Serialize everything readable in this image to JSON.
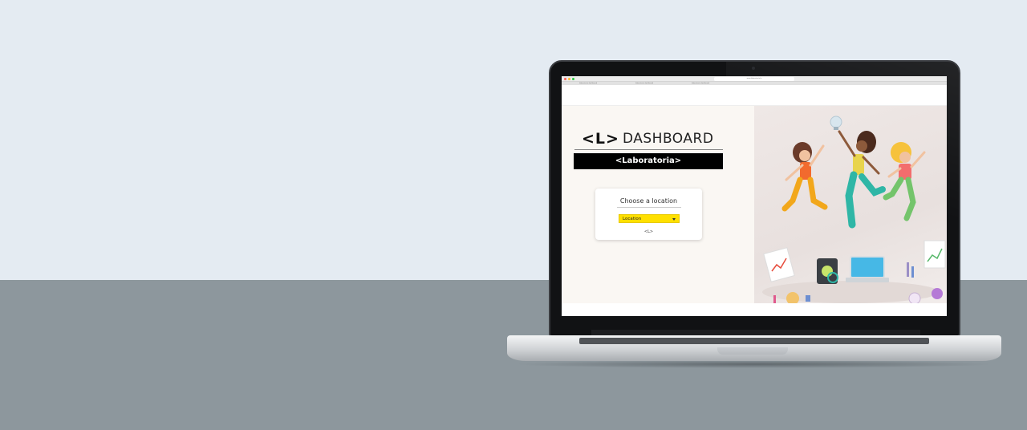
{
  "browser": {
    "url": "www.laboratoria.la",
    "tabs": [
      "laboratoria dashboard",
      "laboratoria dashboard",
      "laboratoria dashboard"
    ]
  },
  "dashboard": {
    "logo_mark": "<L>",
    "logo_title": "DASHBOARD",
    "brand": "<Laboratoria>"
  },
  "location_card": {
    "title": "Choose a location",
    "select_value": "Location",
    "footer_logo": "<L>"
  },
  "colors": {
    "accent_yellow": "#ffe000",
    "brand_black": "#000000",
    "panel_bg": "#faf7f3",
    "desk": "#8d979d",
    "wall": "#e4ebf2"
  },
  "icons": [
    "camera-icon",
    "caret-down-icon",
    "laptop-illustration-icon",
    "lightbulb-icon",
    "chart-icon"
  ]
}
